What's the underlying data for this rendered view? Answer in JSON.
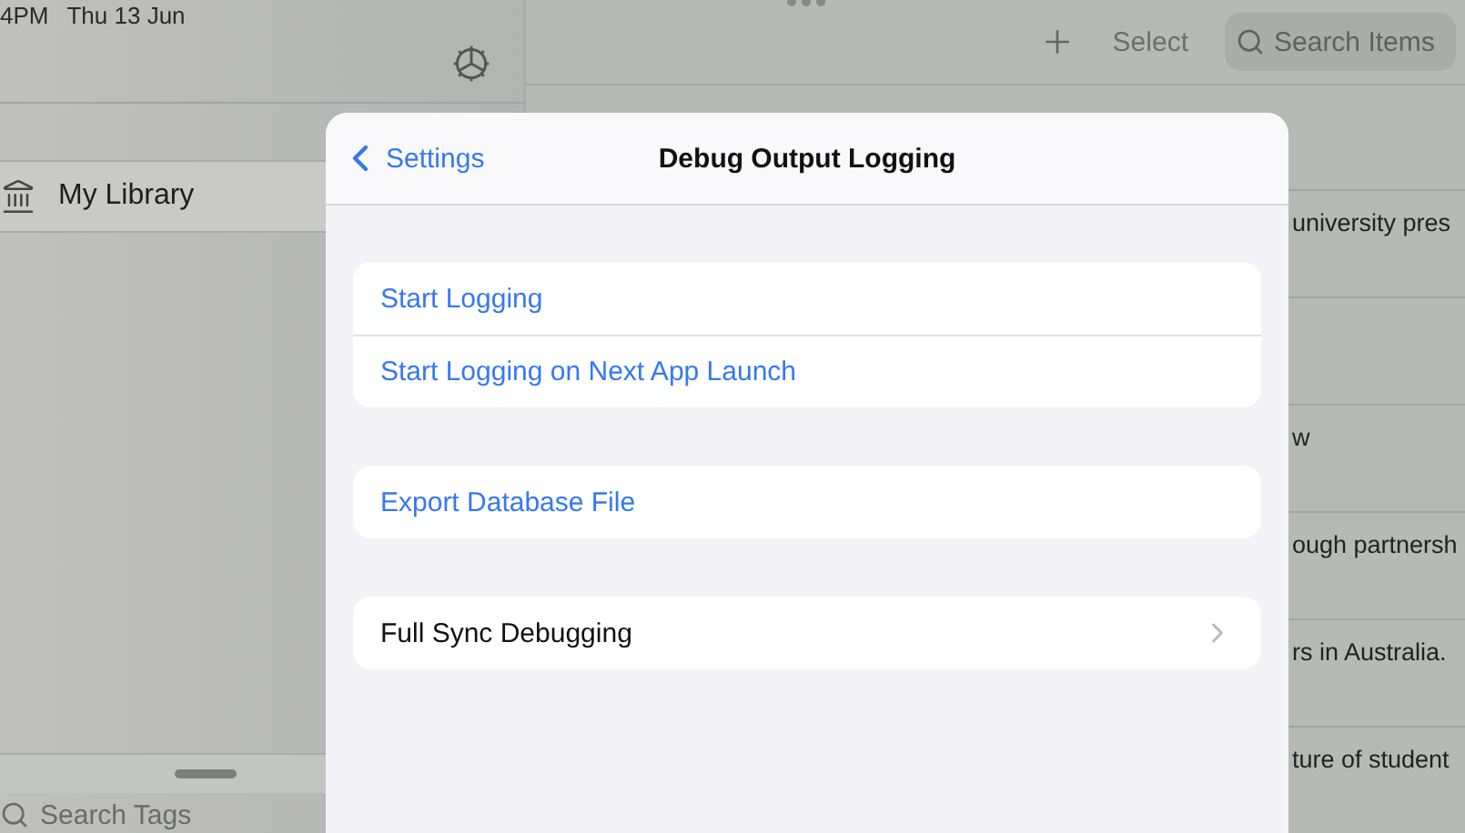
{
  "status_bar": {
    "time": "4PM",
    "date": "Thu 13 Jun"
  },
  "sidebar": {
    "items": [
      {
        "label": "My Library",
        "selected": true
      }
    ],
    "search": {
      "placeholder": "Search Tags"
    }
  },
  "toolbar": {
    "select_label": "Select",
    "search": {
      "placeholder": "Search Items"
    }
  },
  "rows": [
    {
      "title": "university pres"
    },
    {},
    {
      "title": "w"
    },
    {
      "title": "ough partnersh"
    },
    {
      "title": "rs in Australia."
    },
    {
      "title": "ture of student"
    }
  ],
  "modal": {
    "back_label": "Settings",
    "title": "Debug Output Logging",
    "groups": [
      {
        "rows": [
          {
            "label": "Start Logging",
            "kind": "action"
          },
          {
            "label": "Start Logging on Next App Launch",
            "kind": "action"
          }
        ]
      },
      {
        "rows": [
          {
            "label": "Export Database File",
            "kind": "action"
          }
        ]
      },
      {
        "rows": [
          {
            "label": "Full Sync Debugging",
            "kind": "link"
          }
        ]
      }
    ]
  }
}
